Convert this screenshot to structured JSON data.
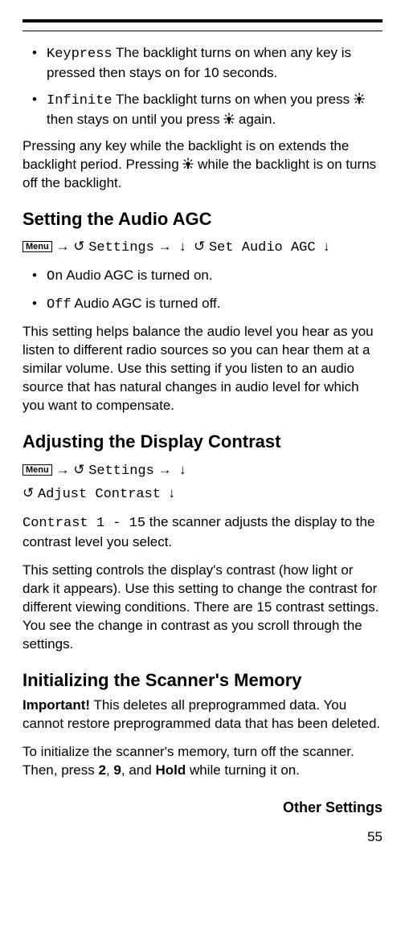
{
  "bullets_top": [
    {
      "term": "Keypress",
      "desc": " The backlight turns on when any key is pressed then stays on for 10 seconds."
    },
    {
      "term": "Infinite",
      "desc_before": " The backlight turns on when you press ",
      "desc_mid": " then stays on until you press ",
      "desc_after": " again."
    }
  ],
  "para_backlight_a": "Pressing any key while the backlight is on extends the backlight period. Pressing ",
  "para_backlight_b": " while the backlight is on turns off the backlight.",
  "sec_agc": {
    "heading": "Setting the Audio AGC",
    "menu": "Menu",
    "nav1": "Settings",
    "nav2": "Set Audio AGC",
    "arrow_r": "→",
    "arrow_d": "↓",
    "rotate": "↺",
    "items": [
      {
        "term": "On",
        "desc": " Audio AGC is turned on."
      },
      {
        "term": "Off",
        "desc": " Audio AGC is turned off."
      }
    ],
    "para": "This setting helps balance the audio level you hear as you listen to different radio sources so you can hear them at a similar volume. Use this setting if you listen to an audio source that has natural changes in audio level for which you want to compensate."
  },
  "sec_contrast": {
    "heading": "Adjusting the Display Contrast",
    "menu": "Menu",
    "nav1": "Settings",
    "nav2": "Adjust Contrast",
    "arrow_r": "→",
    "arrow_d": "↓",
    "rotate": "↺",
    "range_label": "Contrast 1",
    "range_sep": " - ",
    "range_end": "15",
    "range_desc": " the scanner adjusts the display to the contrast level you select.",
    "para": "This setting controls the display's contrast (how light or dark it appears). Use this setting to change the contrast for different viewing conditions. There are 15 contrast settings. You see the change in contrast as you scroll through the settings."
  },
  "sec_init": {
    "heading": "Initializing the Scanner's Memory",
    "important_label": "Important!",
    "important_text": " This deletes all preprogrammed data. You cannot restore preprogrammed data that has been deleted.",
    "para_a": "To initialize the scanner's memory, turn off the scanner. Then, press ",
    "k2": "2",
    "sep1": ", ",
    "k9": "9",
    "sep2": ", and ",
    "khold": "Hold",
    "para_b": " while turning it on."
  },
  "footer": "Other Settings",
  "pagenum": "55"
}
